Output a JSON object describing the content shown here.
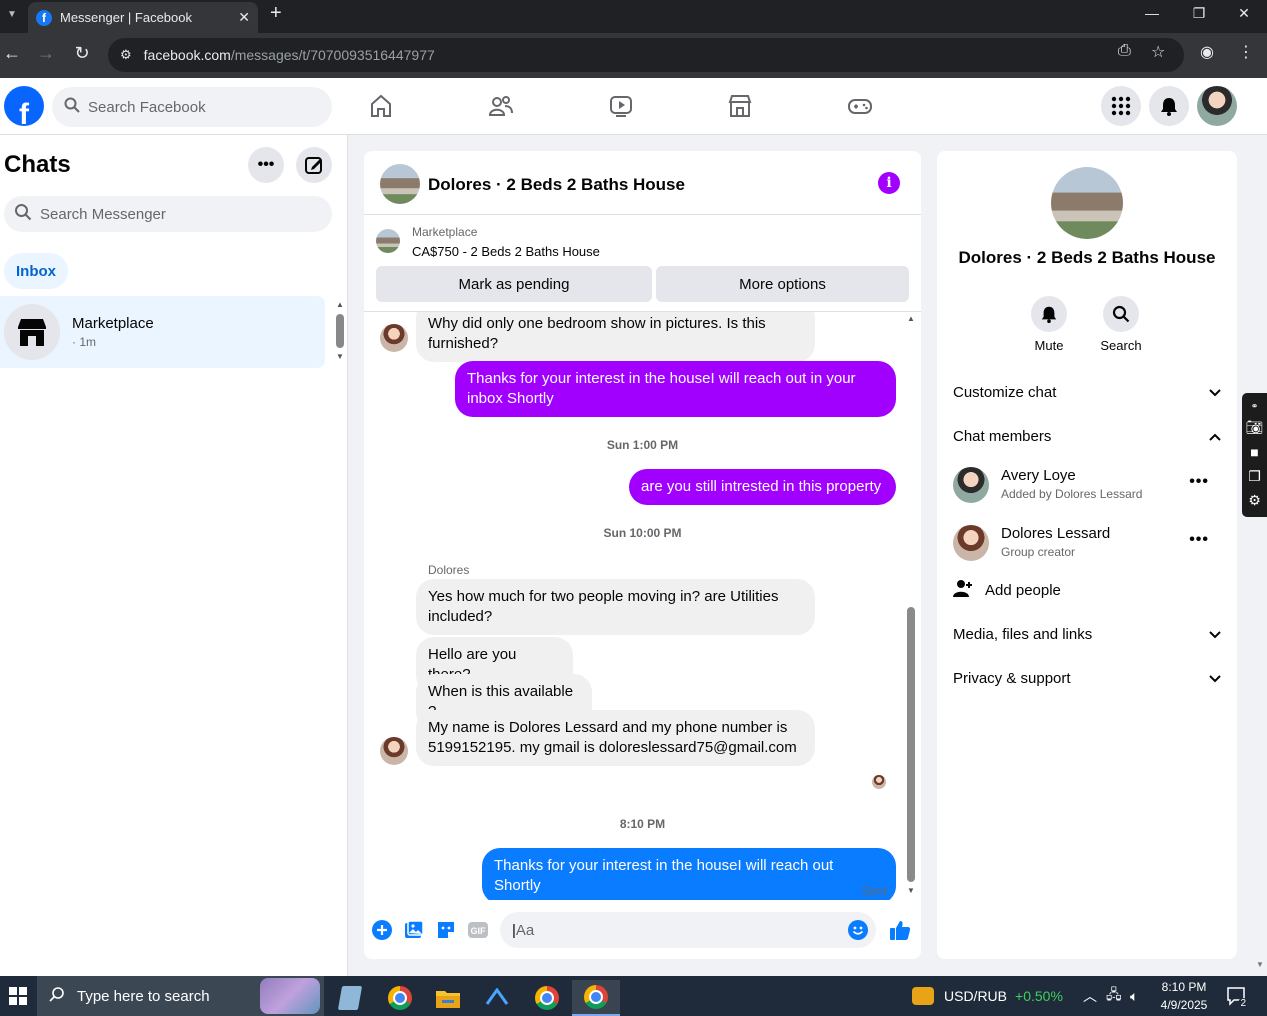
{
  "browser": {
    "tab_title": "Messenger | Facebook",
    "url_host": "facebook.com",
    "url_path": "/messages/t/7070093516447977"
  },
  "fb_header": {
    "search_placeholder": "Search Facebook"
  },
  "sidebar": {
    "title": "Chats",
    "search_placeholder": "Search Messenger",
    "filter_inbox": "Inbox",
    "chats": [
      {
        "name": "Marketplace",
        "time": "· 1m"
      }
    ]
  },
  "conversation": {
    "title": "Dolores · 2 Beds 2 Baths House",
    "marketplace_label": "Marketplace",
    "listing": "CA$750 - 2 Beds 2 Baths House",
    "mark_pending": "Mark as pending",
    "more_options": "More options",
    "messages": [
      {
        "text": "Why did only one bedroom show in pictures. Is this furnished?"
      },
      {
        "text": "Thanks for your interest in the houseI will reach out in your inbox Shortly"
      },
      {
        "text": "are you still intrested in this property"
      },
      {
        "text": "Yes how much for two people moving in? are Utilities included?"
      },
      {
        "text": "Hello are you there?"
      },
      {
        "text": "When is this available ?"
      },
      {
        "text": "My name is Dolores Lessard and my phone number is 5199152195. my gmail is doloreslessard75@gmail.com"
      },
      {
        "text": "Thanks for your interest in the houseI will reach out Shortly"
      }
    ],
    "timestamps": [
      "Sun 1:00 PM",
      "Sun 10:00 PM",
      "8:10 PM"
    ],
    "sender_name": "Dolores",
    "sent_status": "Sent",
    "composer_placeholder": "Aa",
    "colors": {
      "accent": "#a100ff",
      "outgoing_purple": "#a100ff",
      "outgoing_blue": "#0a7cff"
    }
  },
  "info_panel": {
    "title": "Dolores · 2 Beds 2 Baths House",
    "mute": "Mute",
    "search": "Search",
    "customize_chat": "Customize chat",
    "chat_members": "Chat members",
    "members": [
      {
        "name": "Avery Loye",
        "sub": "Added by Dolores Lessard"
      },
      {
        "name": "Dolores Lessard",
        "sub": "Group creator"
      }
    ],
    "add_people": "Add people",
    "media": "Media, files and links",
    "privacy": "Privacy & support"
  },
  "taskbar": {
    "search_placeholder": "Type here to search",
    "ticker_name": "USD/RUB",
    "ticker_change": "+0.50%",
    "time": "8:10 PM",
    "date": "4/9/2025",
    "notifications": "2"
  }
}
